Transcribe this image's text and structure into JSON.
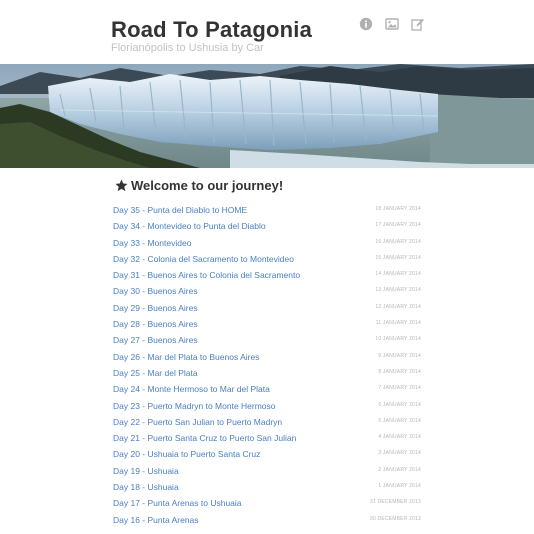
{
  "site": {
    "title": "Road To Patagonia",
    "subtitle": "Florianópolis to Ushusia by Car"
  },
  "header_icons": [
    "info-icon",
    "photo-icon",
    "edit-icon"
  ],
  "colors": {
    "title": "#333333",
    "subtitle": "#c2c2c2",
    "link": "#4a7fc1",
    "date": "#b5b5b5",
    "icon": "#b0b0b0"
  },
  "banner": {
    "alt": "Glacier panorama"
  },
  "section": {
    "title": "Welcome to our journey!",
    "icon": "star-icon"
  },
  "posts": [
    {
      "title": "Day 35 - Punta del Diablo to HOME",
      "date": "18 JANUARY 2014"
    },
    {
      "title": "Day 34 - Montevideo to Punta del Diablo",
      "date": "17 JANUARY 2014"
    },
    {
      "title": "Day 33 - Montevideo",
      "date": "16 JANUARY 2014"
    },
    {
      "title": "Day 32 - Colonia del Sacramento to Montevideo",
      "date": "15 JANUARY 2014"
    },
    {
      "title": "Day 31 - Buenos Aires to Colonia del Sacramento",
      "date": "14 JANUARY 2014"
    },
    {
      "title": "Day 30 - Buenos Aires",
      "date": "13 JANUARY 2014"
    },
    {
      "title": "Day 29 - Buenos Aires",
      "date": "12 JANUARY 2014"
    },
    {
      "title": "Day 28 - Buenos Aires",
      "date": "11 JANUARY 2014"
    },
    {
      "title": "Day 27 - Buenos Aires",
      "date": "10 JANUARY 2014"
    },
    {
      "title": "Day 26 - Mar del Plata to Buenos Aires",
      "date": "9 JANUARY 2014"
    },
    {
      "title": "Day 25 - Mar del Plata",
      "date": "8 JANUARY 2014"
    },
    {
      "title": "Day 24 - Monte Hermoso to Mar del Plata",
      "date": "7 JANUARY 2014"
    },
    {
      "title": "Day 23 - Puerto Madryn to Monte Hermoso",
      "date": "6 JANUARY 2014"
    },
    {
      "title": "Day 22 - Puerto San Julian to Puerto Madryn",
      "date": "5 JANUARY 2014"
    },
    {
      "title": "Day 21 - Puerto Santa Cruz to Puerto San Julian",
      "date": "4 JANUARY 2014"
    },
    {
      "title": "Day 20 - Ushuaia to Puerto Santa Cruz",
      "date": "3 JANUARY 2014"
    },
    {
      "title": "Day 19 - Ushuaia",
      "date": "2 JANUARY 2014"
    },
    {
      "title": "Day 18 - Ushuaia",
      "date": "1 JANUARY 2014"
    },
    {
      "title": "Day 17 - Punta Arenas to Ushuaia",
      "date": "31 DECEMBER 2013"
    },
    {
      "title": "Day 16 - Punta Arenas",
      "date": "30 DECEMBER 2013"
    }
  ]
}
